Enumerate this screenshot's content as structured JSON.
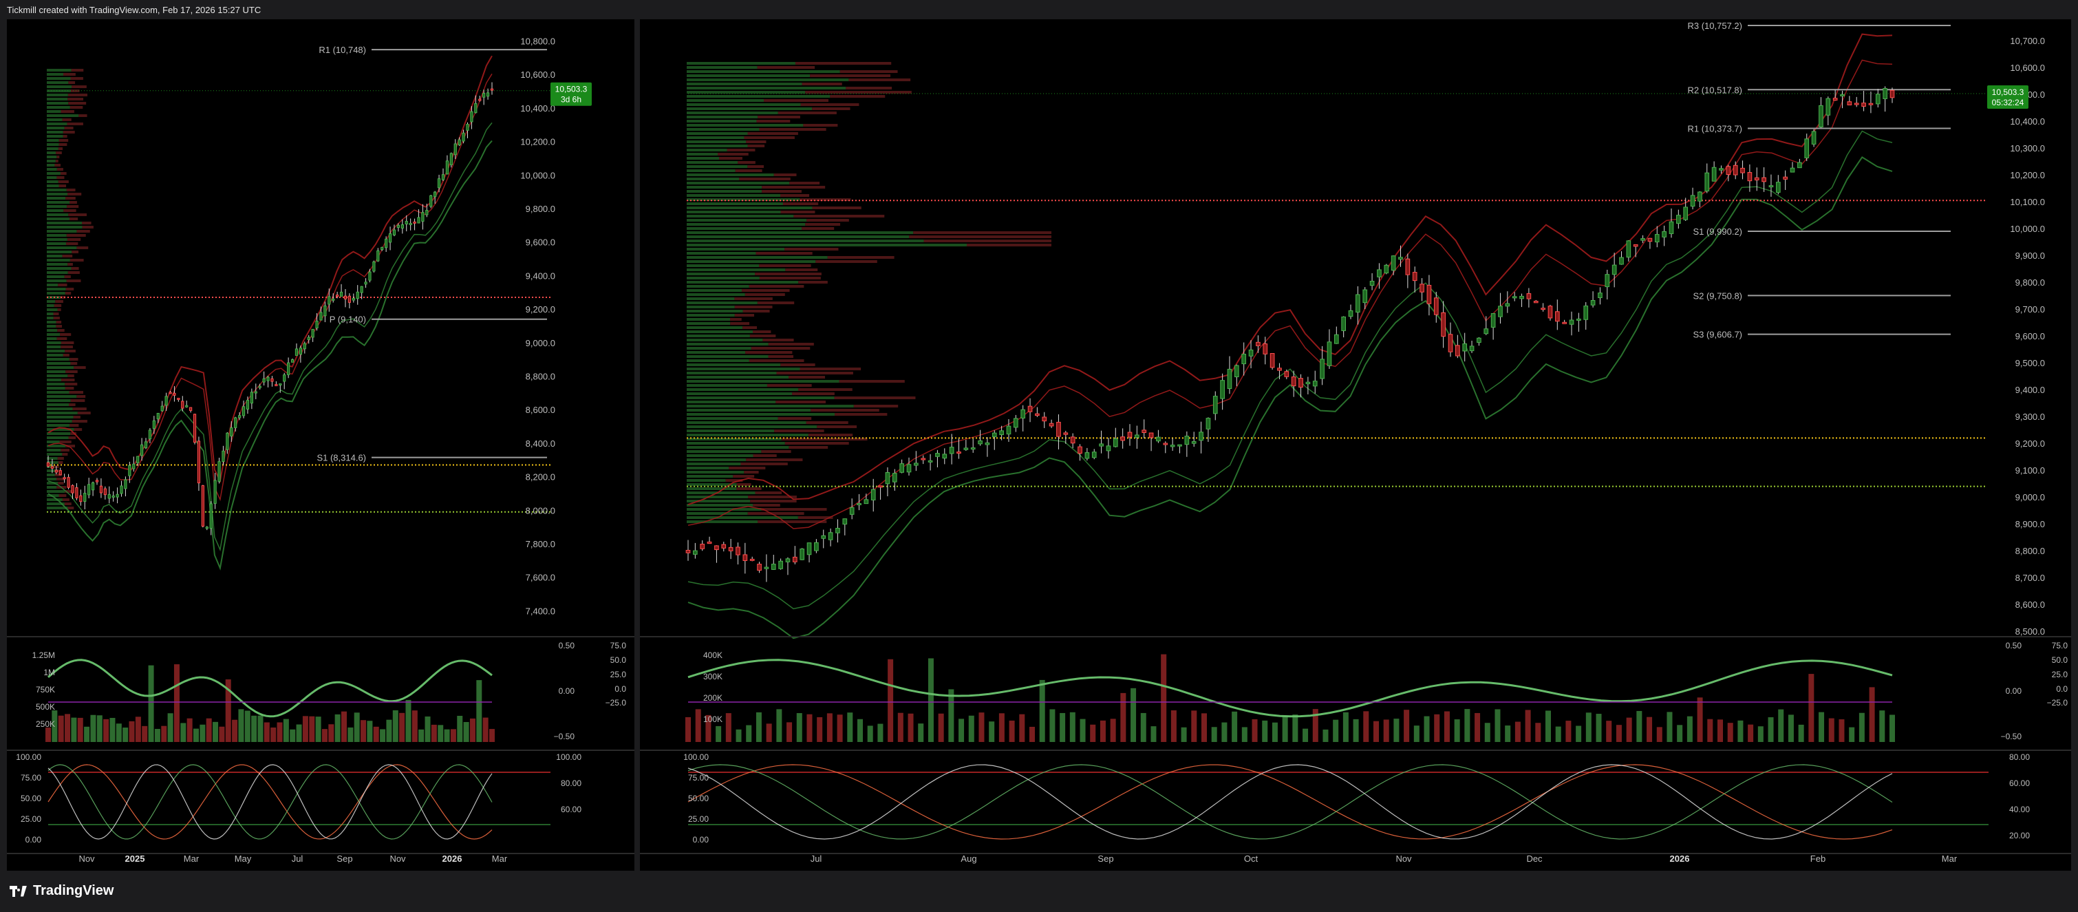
{
  "header": {
    "attribution": "Tickmill created with TradingView.com, Feb 17, 2026 15:27 UTC"
  },
  "footer": {
    "brand": "TradingView"
  },
  "colors": {
    "background": "#000000",
    "up": "#2e7d32",
    "down": "#c62828",
    "up_bright": "#4caf50",
    "down_bright": "#ff4d4d",
    "price_tag": "#1b8a1b",
    "pivot_line": "#9e9e9e"
  },
  "chart_data": [
    {
      "id": "left-weekly",
      "type": "candlestick",
      "price_axis": {
        "ticks": [
          "10,800.0",
          "10,600.0",
          "10,400.0",
          "10,200.0",
          "10,000.0",
          "9,800.0",
          "9,600.0",
          "9,400.0",
          "9,200.0",
          "9,000.0",
          "8,800.0",
          "8,600.0",
          "8,400.0",
          "8,200.0",
          "8,000.0",
          "7,800.0",
          "7,600.0",
          "7,400.0"
        ],
        "ylim": [
          7340,
          10880
        ]
      },
      "time_axis": {
        "ticks": [
          "Nov",
          "2025",
          "Mar",
          "May",
          "Jul",
          "Sep",
          "Nov",
          "2026",
          "Mar"
        ]
      },
      "price_label": {
        "value": "10,503.3",
        "sub": "3d 6h"
      },
      "pivots": [
        {
          "label": "R1 (10,748)",
          "value": 10748
        },
        {
          "label": "P (9,140)",
          "value": 9140
        },
        {
          "label": "S1 (8,314.6)",
          "value": 8314.6
        }
      ],
      "volume_axis": {
        "ticks": [
          "1.25M",
          "1M",
          "750K",
          "500K",
          "250K"
        ]
      },
      "osc_axis": {
        "ticks": [
          "0.50",
          "0.00",
          "−0.50"
        ],
        "ticks2": [
          "75.0",
          "50.0",
          "25.0",
          "0.0",
          "−25.0"
        ]
      },
      "stoch_axis": {
        "ticks": [
          "100.00",
          "75.00",
          "50.00",
          "25.00",
          "0.00"
        ],
        "ticks_right": [
          "100.00",
          "80.00",
          "60.00"
        ]
      },
      "path": [
        8280,
        8240,
        8150,
        8060,
        8180,
        8080,
        8100,
        8260,
        8380,
        8560,
        8700,
        8640,
        8580,
        7820,
        8230,
        8480,
        8600,
        8710,
        8790,
        8740,
        8900,
        9000,
        9100,
        9260,
        9290,
        9240,
        9360,
        9540,
        9640,
        9720,
        9700,
        9800,
        9960,
        10120,
        10260,
        10440,
        10503
      ]
    },
    {
      "id": "right-daily",
      "type": "candlestick",
      "price_axis": {
        "ticks": [
          "10,700.0",
          "10,600.0",
          "10,500.0",
          "10,400.0",
          "10,300.0",
          "10,200.0",
          "10,100.0",
          "10,000.0",
          "9,900.0",
          "9,800.0",
          "9,700.0",
          "9,600.0",
          "9,500.0",
          "9,400.0",
          "9,300.0",
          "9,200.0",
          "9,100.0",
          "9,000.0",
          "8,900.0",
          "8,800.0",
          "8,700.0",
          "8,600.0",
          "8,500.0"
        ],
        "ylim": [
          8480,
          10775
        ]
      },
      "time_axis": {
        "ticks": [
          "Jul",
          "Aug",
          "Sep",
          "Oct",
          "Nov",
          "Dec",
          "2026",
          "Feb",
          "Mar"
        ]
      },
      "price_label": {
        "value": "10,503.3",
        "sub": "05:32:24"
      },
      "pivots": [
        {
          "label": "R3 (10,757.2)",
          "value": 10757.2
        },
        {
          "label": "R2 (10,517.8)",
          "value": 10517.8
        },
        {
          "label": "R1 (10,373.7)",
          "value": 10373.7
        },
        {
          "label": "S1 (9,990.2)",
          "value": 9990.2
        },
        {
          "label": "S2 (9,750.8)",
          "value": 9750.8
        },
        {
          "label": "S3 (9,606.7)",
          "value": 9606.7
        }
      ],
      "volume_axis": {
        "ticks": [
          "400K",
          "300K",
          "200K",
          "100K"
        ]
      },
      "osc_axis": {
        "ticks": [
          "0.50",
          "0.00",
          "−0.50"
        ],
        "ticks2": [
          "75.0",
          "50.0",
          "25.0",
          "0.0",
          "−25.0"
        ]
      },
      "stoch_axis": {
        "ticks": [
          "100.00",
          "75.00",
          "50.00",
          "25.00",
          "0.00"
        ],
        "ticks_right": [
          "80.00",
          "60.00",
          "40.00",
          "20.00"
        ]
      },
      "path": [
        8790,
        8830,
        8800,
        8720,
        8780,
        8850,
        8960,
        9060,
        9130,
        9160,
        9190,
        9230,
        9330,
        9260,
        9150,
        9210,
        9250,
        9190,
        9230,
        9440,
        9580,
        9440,
        9420,
        9650,
        9800,
        9900,
        9750,
        9520,
        9620,
        9760,
        9700,
        9640,
        9760,
        9940,
        9970,
        10060,
        10230,
        10210,
        10150,
        10250,
        10500,
        10460,
        10503
      ]
    }
  ]
}
